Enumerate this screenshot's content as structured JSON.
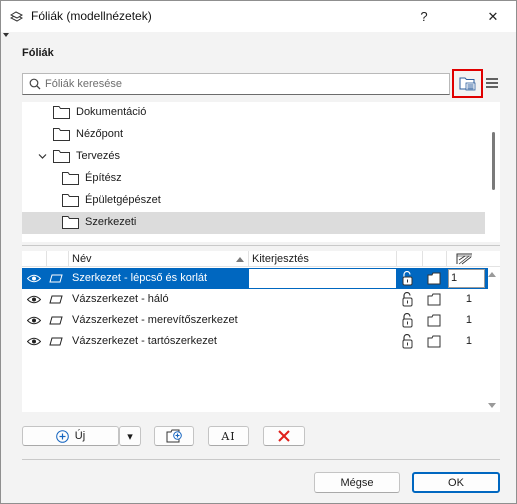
{
  "window": {
    "title": "Fóliák (modellnézetek)",
    "help_glyph": "?",
    "close_glyph": "✕"
  },
  "section": {
    "title": "Fóliák"
  },
  "search": {
    "placeholder": "Fóliák keresése",
    "value": ""
  },
  "tree": {
    "items": [
      {
        "label": "Dokumentáció",
        "expanded": false,
        "selected": false
      },
      {
        "label": "Nézőpont",
        "expanded": false,
        "selected": false
      },
      {
        "label": "Tervezés",
        "expanded": true,
        "selected": false
      },
      {
        "label": "Építész",
        "expanded": false,
        "selected": false
      },
      {
        "label": "Épületgépészet",
        "expanded": false,
        "selected": false
      },
      {
        "label": "Szerkezeti",
        "expanded": false,
        "selected": true
      }
    ]
  },
  "table": {
    "headers": {
      "name": "Név",
      "extension": "Kiterjesztés"
    },
    "rows": [
      {
        "name": "Szerkezet - lépcső és korlát",
        "extension": "",
        "number": "1",
        "selected": true
      },
      {
        "name": "Vázszerkezet - háló",
        "extension": "",
        "number": "1",
        "selected": false
      },
      {
        "name": "Vázszerkezet - merevítőszerkezet",
        "extension": "",
        "number": "1",
        "selected": false
      },
      {
        "name": "Vázszerkezet - tartószerkezet",
        "extension": "",
        "number": "1",
        "selected": false
      }
    ]
  },
  "toolbar": {
    "new_label": "Új",
    "new_dropdown_glyph": "▾",
    "text_button_glyph": "AI"
  },
  "footer": {
    "cancel_label": "Mégse",
    "ok_label": "OK"
  },
  "colors": {
    "accent": "#0067c0",
    "highlight_frame": "#e00000",
    "delete_red": "#e0201b",
    "add_blue": "#1565c0"
  }
}
